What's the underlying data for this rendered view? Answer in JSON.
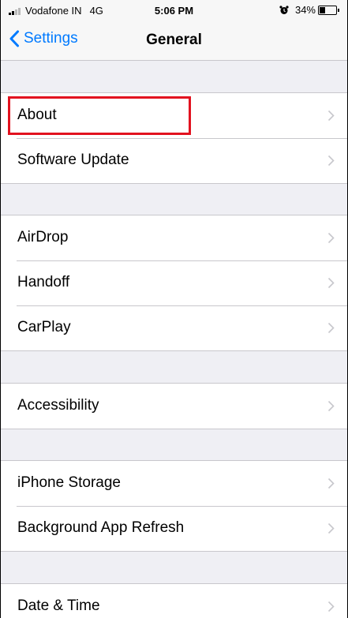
{
  "status_bar": {
    "carrier": "Vodafone IN",
    "network": "4G",
    "time": "5:06 PM",
    "battery_percent": "34%",
    "battery_level": 0.34,
    "icons": [
      "signal-icon",
      "alarm-icon",
      "battery-icon"
    ]
  },
  "nav": {
    "back_label": "Settings",
    "title": "General"
  },
  "groups": [
    {
      "rows": [
        {
          "label": "About"
        },
        {
          "label": "Software Update"
        }
      ]
    },
    {
      "rows": [
        {
          "label": "AirDrop"
        },
        {
          "label": "Handoff"
        },
        {
          "label": "CarPlay"
        }
      ]
    },
    {
      "rows": [
        {
          "label": "Accessibility"
        }
      ]
    },
    {
      "rows": [
        {
          "label": "iPhone Storage"
        },
        {
          "label": "Background App Refresh"
        }
      ]
    },
    {
      "rows": [
        {
          "label": "Date & Time"
        }
      ]
    }
  ],
  "colors": {
    "accent": "#007aff",
    "highlight": "#e2121f",
    "background": "#efeff4"
  }
}
